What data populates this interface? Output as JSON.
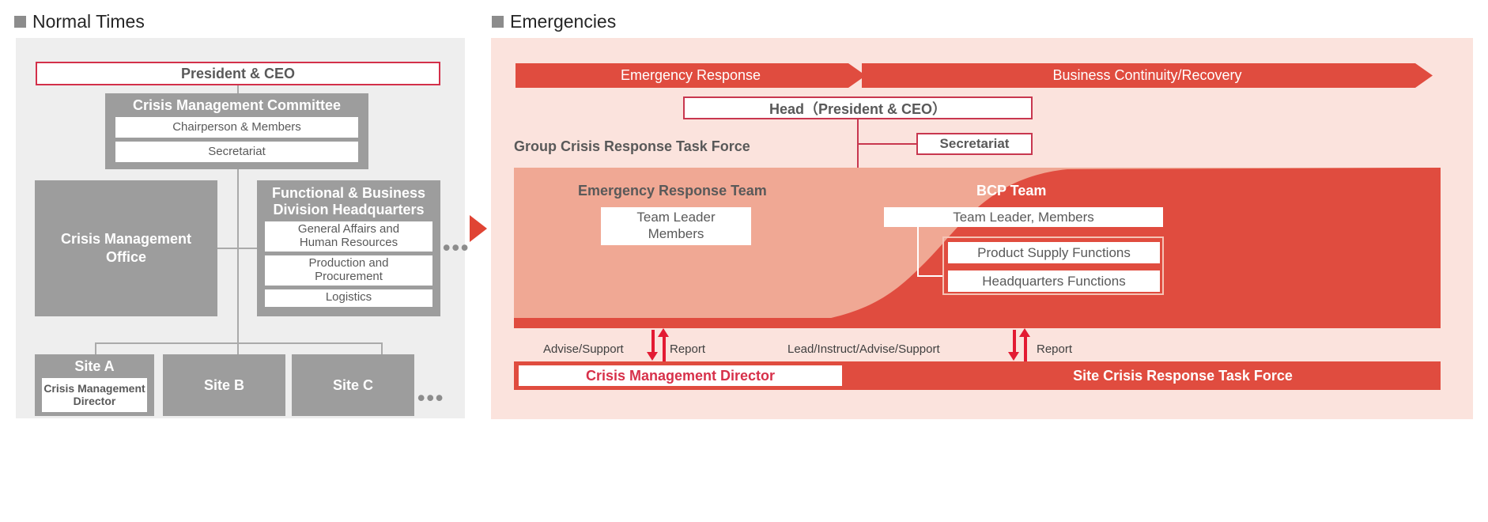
{
  "headings": {
    "left": "Normal Times",
    "right": "Emergencies"
  },
  "colors": {
    "panel_left_bg": "#eeeeee",
    "panel_right_bg": "#fbe3dd",
    "grey_box": "#9d9d9d",
    "accent_red": "#d3304a",
    "banner_red": "#e04c3f",
    "salmon": "#f0a894",
    "arrow_red": "#e31b33"
  },
  "normal_times": {
    "ceo": "President & CEO",
    "committee": {
      "title": "Crisis Management Committee",
      "rows": [
        "Chairperson & Members",
        "Secretariat"
      ]
    },
    "crisis_office": "Crisis Management\nOffice",
    "crisis_office_line1": "Crisis Management",
    "crisis_office_line2": "Office",
    "divisions": {
      "title_line1": "Functional & Business",
      "title_line2": "Division Headquarters",
      "rows": [
        "General Affairs and\nHuman Resources",
        "Production and\nProcurement",
        "Logistics"
      ],
      "rows_split": [
        [
          "General Affairs and",
          "Human Resources"
        ],
        [
          "Production and",
          "Procurement"
        ],
        [
          "Logistics",
          ""
        ]
      ],
      "ellipsis": "•••"
    },
    "sites": [
      {
        "name": "Site A",
        "role_line1": "Crisis Management",
        "role_line2": "Director"
      },
      {
        "name": "Site B",
        "role_line1": "",
        "role_line2": ""
      },
      {
        "name": "Site C",
        "role_line1": "",
        "role_line2": ""
      }
    ],
    "sites_ellipsis": "•••"
  },
  "transition_arrow": "right-triangle-arrow",
  "emergencies": {
    "phase_banners": [
      "Emergency Response",
      "Business Continuity/Recovery"
    ],
    "head": "Head（President & CEO）",
    "secretariat": "Secretariat",
    "task_force_label": "Group Crisis Response Task Force",
    "emergency_response_team": {
      "title": "Emergency Response Team",
      "box_line1": "Team Leader",
      "box_line2": "Members"
    },
    "bcp_team": {
      "title": "BCP Team",
      "team_leader": "Team Leader, Members",
      "functions": [
        "Product Supply Functions",
        "Headquarters Functions"
      ]
    },
    "flows": {
      "left_down": "Advise/Support",
      "left_up": "Report",
      "right_down": "Lead/Instruct/Advise/Support",
      "right_up": "Report"
    },
    "bottom": {
      "crisis_management_director": "Crisis Management Director",
      "site_task_force": "Site Crisis Response Task Force"
    }
  }
}
